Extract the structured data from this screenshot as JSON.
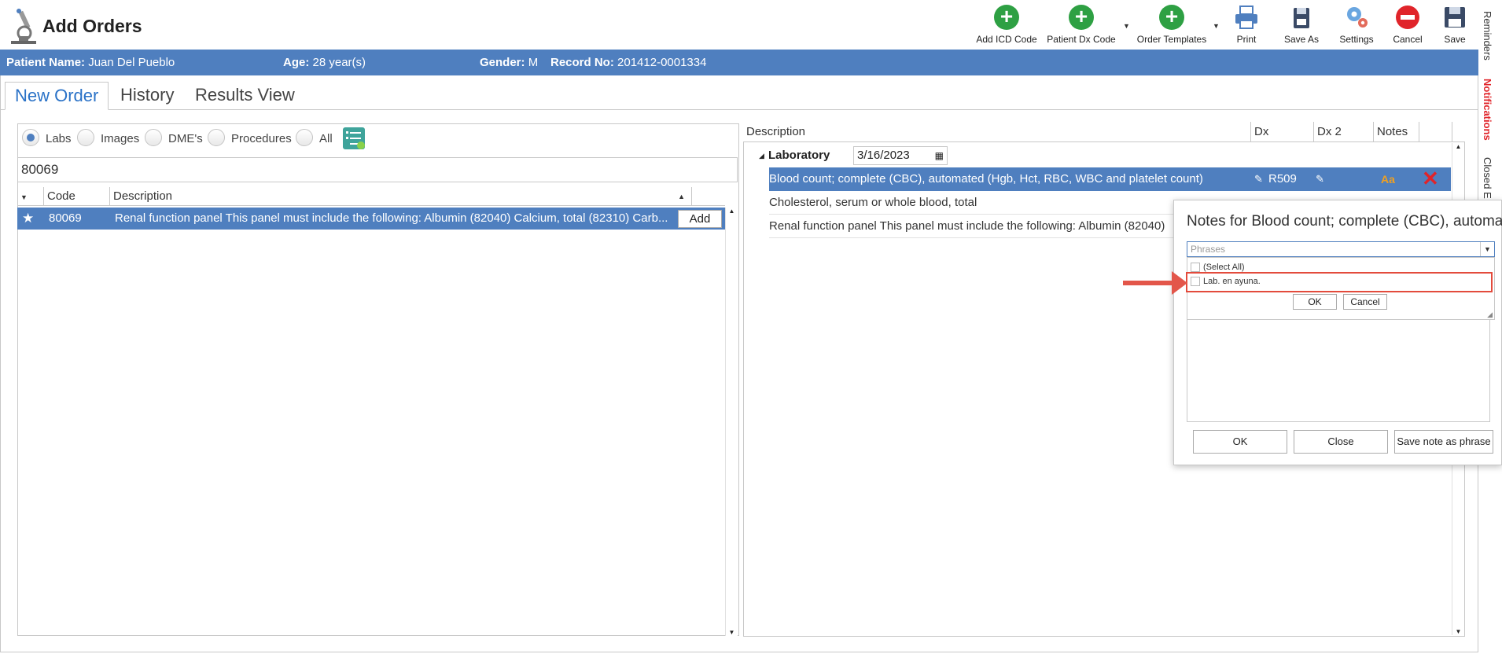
{
  "app": {
    "title": "Add Orders"
  },
  "toolbar": {
    "add_icd": "Add ICD Code",
    "patient_dx": "Patient Dx Code",
    "order_templates": "Order Templates",
    "print": "Print",
    "save_as": "Save As",
    "settings": "Settings",
    "cancel": "Cancel",
    "save": "Save"
  },
  "patient": {
    "name_label": "Patient Name:",
    "name": "Juan Del Pueblo",
    "age_label": "Age:",
    "age": "28 year(s)",
    "gender_label": "Gender:",
    "gender": "M",
    "record_label": "Record No:",
    "record": "201412-0001334"
  },
  "side_tabs": [
    "Reminders",
    "Notifications",
    "Closed E"
  ],
  "tabs": [
    "New Order",
    "History",
    "Results View"
  ],
  "filters": {
    "options": [
      "Labs",
      "Images",
      "DME's",
      "Procedures",
      "All"
    ],
    "selected": "Labs"
  },
  "search": {
    "value": "80069"
  },
  "left_grid": {
    "columns": [
      "Code",
      "Description"
    ],
    "rows": [
      {
        "code": "80069",
        "description": "Renal function panel This panel must include the following: Albumin (82040) Calcium, total (82310) Carb...",
        "action": "Add"
      }
    ]
  },
  "right_grid": {
    "columns": [
      "Description",
      "Dx",
      "Dx 2",
      "Notes"
    ],
    "group": {
      "label": "Laboratory",
      "date": "3/16/2023"
    },
    "rows": [
      {
        "description": "Blood count; complete (CBC), automated (Hgb, Hct, RBC, WBC and platelet count)",
        "dx": "R509"
      },
      {
        "description": "Cholesterol, serum or whole blood, total",
        "dx": ""
      },
      {
        "description": "Renal function panel This panel must include the following: Albumin (82040)",
        "dx": ""
      }
    ]
  },
  "notes_dialog": {
    "title": "Notes for Blood count; complete (CBC), automated",
    "phrases_placeholder": "Phrases",
    "phrase_items": [
      "(Select All)",
      "Lab. en ayuna."
    ],
    "dd_ok": "OK",
    "dd_cancel": "Cancel",
    "ok": "OK",
    "close": "Close",
    "save_phrase": "Save note as phrase"
  },
  "colors": {
    "accent": "#4f7fbf",
    "green": "#2ea043",
    "red": "#e0242a",
    "highlight": "#e34b3c"
  }
}
